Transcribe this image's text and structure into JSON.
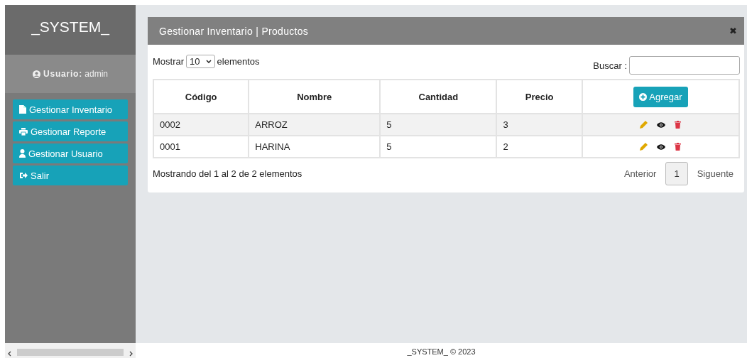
{
  "sidebar": {
    "brand": "_SYSTEM_",
    "user_label": "Usuario:",
    "user_name": "admin",
    "menu": [
      {
        "label": "Gestionar Inventario",
        "kind": "file"
      },
      {
        "label": "Gestionar Reporte",
        "kind": "print"
      },
      {
        "label": "Gestionar Usuario",
        "kind": "user"
      },
      {
        "label": "Salir",
        "kind": "exit"
      }
    ]
  },
  "panel": {
    "title": "Gestionar Inventario | Productos",
    "close": "✖",
    "length": {
      "before": "Mostrar",
      "value": "10",
      "after": "elementos"
    },
    "search": {
      "label": "Buscar :"
    },
    "table": {
      "columns": [
        "Código",
        "Nombre",
        "Cantidad",
        "Precio"
      ],
      "add_button": "Agregar",
      "rows": [
        [
          "0002",
          "ARROZ",
          "5",
          "3"
        ],
        [
          "0001",
          "HARINA",
          "5",
          "2"
        ]
      ]
    },
    "info": "Mostrando del 1 al 2 de 2 elementos",
    "pagination": [
      {
        "label": "Anterior",
        "kind": "link",
        "selected": false
      },
      {
        "label": "1",
        "kind": "page",
        "selected": true
      },
      {
        "label": "Siguente",
        "kind": "link",
        "selected": false
      }
    ]
  },
  "footer": "_SYSTEM_ © 2023"
}
